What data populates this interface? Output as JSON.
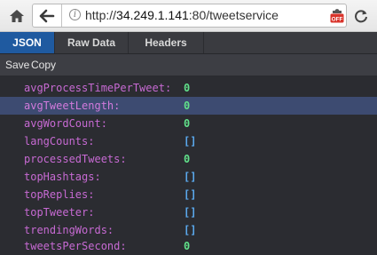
{
  "browser": {
    "url_prefix": "http://",
    "url_host": "34.249.1.141",
    "url_rest": ":80/tweetservice",
    "tracking_badge": "OFF"
  },
  "tabs": [
    {
      "label": "JSON",
      "active": true
    },
    {
      "label": "Raw Data",
      "active": false
    },
    {
      "label": "Headers",
      "active": false
    }
  ],
  "toolbar": {
    "save_label": "Save",
    "copy_label": "Copy"
  },
  "rows": [
    {
      "key": "avgProcessTimePerTweet:",
      "value": "0",
      "type": "number",
      "selected": false
    },
    {
      "key": "avgTweetLength:",
      "value": "0",
      "type": "number",
      "selected": true
    },
    {
      "key": "avgWordCount:",
      "value": "0",
      "type": "number",
      "selected": false
    },
    {
      "key": "langCounts:",
      "value": "[]",
      "type": "array",
      "selected": false
    },
    {
      "key": "processedTweets:",
      "value": "0",
      "type": "number",
      "selected": false
    },
    {
      "key": "topHashtags:",
      "value": "[]",
      "type": "array",
      "selected": false
    },
    {
      "key": "topReplies:",
      "value": "[]",
      "type": "array",
      "selected": false
    },
    {
      "key": "topTweeter:",
      "value": "[]",
      "type": "array",
      "selected": false
    },
    {
      "key": "trendingWords:",
      "value": "[]",
      "type": "array",
      "selected": false
    },
    {
      "key": "tweetsPerSecond:",
      "value": "0",
      "type": "number",
      "selected": false
    }
  ],
  "colors": {
    "key": "#c76ad3",
    "number": "#61e08a",
    "array": "#5aa8ec",
    "active_tab": "#1f5aa0",
    "selected_row": "#3d4b71"
  }
}
